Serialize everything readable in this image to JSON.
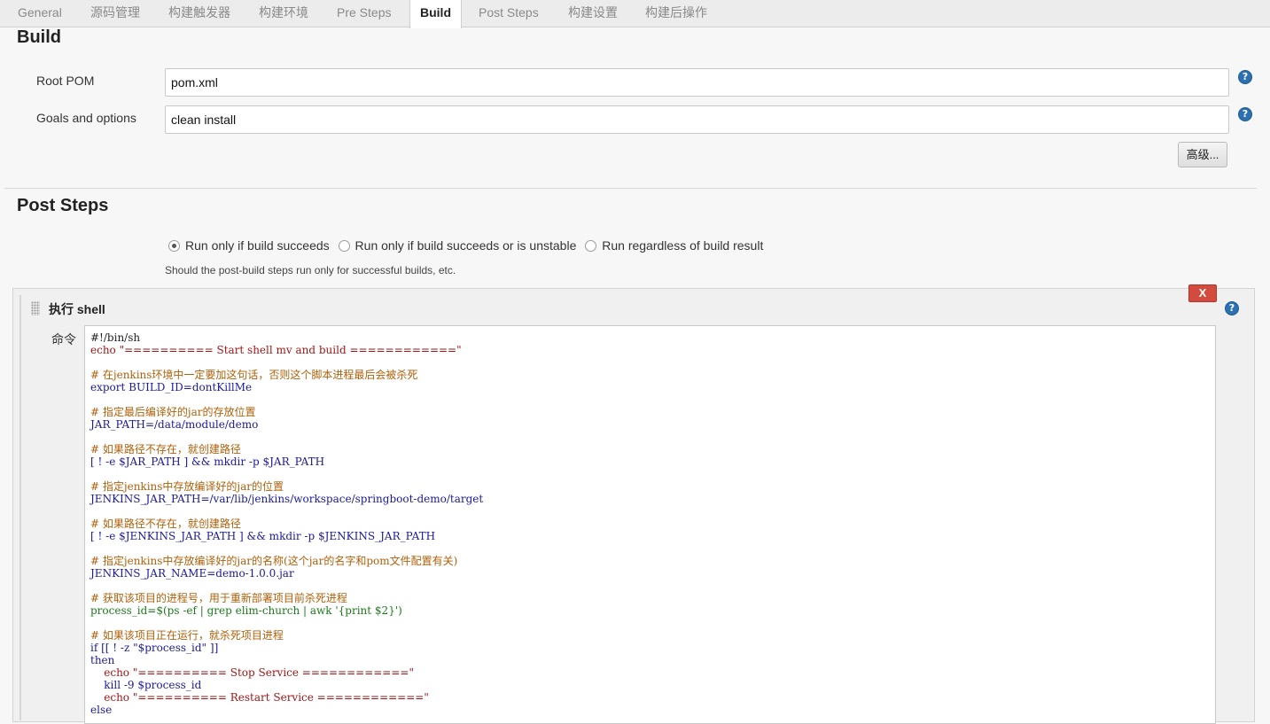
{
  "tabs": [
    {
      "label": "General",
      "active": false
    },
    {
      "label": "源码管理",
      "active": false
    },
    {
      "label": "构建触发器",
      "active": false
    },
    {
      "label": "构建环境",
      "active": false
    },
    {
      "label": "Pre Steps",
      "active": false
    },
    {
      "label": "Build",
      "active": true
    },
    {
      "label": "Post Steps",
      "active": false
    },
    {
      "label": "构建设置",
      "active": false
    },
    {
      "label": "构建后操作",
      "active": false
    }
  ],
  "build": {
    "title": "Build",
    "root_pom_label": "Root POM",
    "root_pom_value": "pom.xml",
    "goals_label": "Goals and options",
    "goals_value": "clean install",
    "advanced_button": "高级..."
  },
  "post_steps": {
    "title": "Post Steps",
    "options": [
      {
        "label": "Run only if build succeeds",
        "checked": true
      },
      {
        "label": "Run only if build succeeds or is unstable",
        "checked": false
      },
      {
        "label": "Run regardless of build result",
        "checked": false
      }
    ],
    "description": "Should the post-build steps run only for successful builds, etc."
  },
  "shell_step": {
    "title": "执行 shell",
    "delete_button": "X",
    "command_label": "命令",
    "lines": [
      {
        "t": "#!/bin/sh",
        "c": "dark"
      },
      {
        "t": "echo \"========== Start shell mv and build ============\"",
        "c": "string"
      },
      {
        "t": "",
        "c": "normal"
      },
      {
        "t": "# 在jenkins环境中一定要加这句话，否则这个脚本进程最后会被杀死",
        "c": "comment"
      },
      {
        "t": "export BUILD_ID=dontKillMe",
        "c": "normal"
      },
      {
        "t": "",
        "c": "normal"
      },
      {
        "t": "# 指定最后编译好的jar的存放位置",
        "c": "comment"
      },
      {
        "t": "JAR_PATH=/data/module/demo",
        "c": "normal"
      },
      {
        "t": "",
        "c": "normal"
      },
      {
        "t": "# 如果路径不存在，就创建路径",
        "c": "comment"
      },
      {
        "t": "[ ! -e $JAR_PATH ] && mkdir -p $JAR_PATH",
        "c": "normal"
      },
      {
        "t": "",
        "c": "normal"
      },
      {
        "t": "# 指定jenkins中存放编译好的jar的位置",
        "c": "comment"
      },
      {
        "t": "JENKINS_JAR_PATH=/var/lib/jenkins/workspace/springboot-demo/target",
        "c": "normal"
      },
      {
        "t": "",
        "c": "normal"
      },
      {
        "t": "# 如果路径不存在，就创建路径",
        "c": "comment"
      },
      {
        "t": "[ ! -e $JENKINS_JAR_PATH ] && mkdir -p $JENKINS_JAR_PATH",
        "c": "normal"
      },
      {
        "t": "",
        "c": "normal"
      },
      {
        "t": "# 指定jenkins中存放编译好的jar的名称(这个jar的名字和pom文件配置有关)",
        "c": "comment"
      },
      {
        "t": "JENKINS_JAR_NAME=demo-1.0.0.jar",
        "c": "normal"
      },
      {
        "t": "",
        "c": "normal"
      },
      {
        "t": "# 获取该项目的进程号，用于重新部署项目前杀死进程",
        "c": "comment"
      },
      {
        "t": "process_id=$(ps -ef | grep elim-church | awk '{print $2}')",
        "c": "green"
      },
      {
        "t": "",
        "c": "normal"
      },
      {
        "t": "# 如果该项目正在运行，就杀死项目进程",
        "c": "comment"
      },
      {
        "t": "if [[ ! -z \"$process_id\" ]]",
        "c": "normal"
      },
      {
        "t": "then",
        "c": "normal"
      },
      {
        "t": "    echo \"========== Stop Service ============\"",
        "c": "string"
      },
      {
        "t": "    kill -9 $process_id",
        "c": "normal"
      },
      {
        "t": "    echo \"========== Restart Service ============\"",
        "c": "string"
      },
      {
        "t": "else",
        "c": "normal"
      }
    ]
  },
  "icons": {
    "help": "help-icon",
    "drag": "drag-handle-icon"
  }
}
